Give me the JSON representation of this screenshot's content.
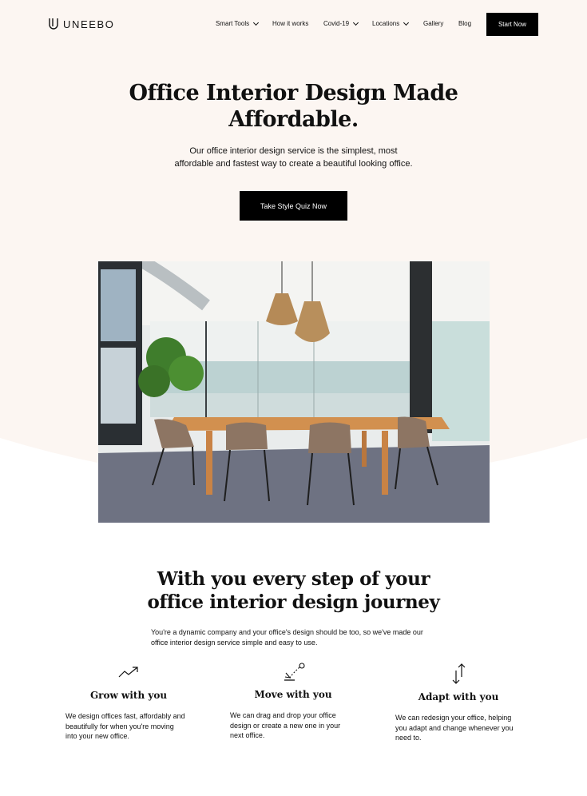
{
  "brand": {
    "name": "UNEEBO"
  },
  "nav": {
    "items": [
      {
        "label": "Smart Tools",
        "dropdown": true
      },
      {
        "label": "How it works",
        "dropdown": false
      },
      {
        "label": "Covid-19",
        "dropdown": true
      },
      {
        "label": "Locations",
        "dropdown": true
      },
      {
        "label": "Gallery",
        "dropdown": false
      },
      {
        "label": "Blog",
        "dropdown": false
      }
    ],
    "cta": "Start Now"
  },
  "hero": {
    "title_line1": "Office Interior Design Made",
    "title_line2": "Affordable.",
    "subtitle_line1": "Our office interior design service is the simplest, most",
    "subtitle_line2": "affordable and fastest way to create a beautiful looking office.",
    "cta": "Take Style Quiz Now"
  },
  "journey": {
    "title_line1": "With you every step of your",
    "title_line2": "office interior design journey",
    "subtitle_line1": "You're a dynamic company and your office's design should be too, so we've made our",
    "subtitle_line2": "office interior design service simple and easy to use."
  },
  "features": [
    {
      "icon": "trend-up-icon",
      "title": "Grow with you",
      "lines": [
        "We design offices fast, affordably and",
        "beautifully for when you're moving",
        "into your new office."
      ]
    },
    {
      "icon": "drag-drop-icon",
      "title": "Move with you",
      "lines": [
        "We can drag and drop your office",
        "design or create a new one in your",
        "next office."
      ]
    },
    {
      "icon": "arrows-up-down-icon",
      "title": "Adapt with you",
      "lines": [
        "We can redesign your office, helping",
        "you adapt and change whenever you",
        "need to."
      ]
    }
  ],
  "colors": {
    "hero_bg": "#fcf6f2",
    "button": "#000000",
    "text": "#111111"
  }
}
